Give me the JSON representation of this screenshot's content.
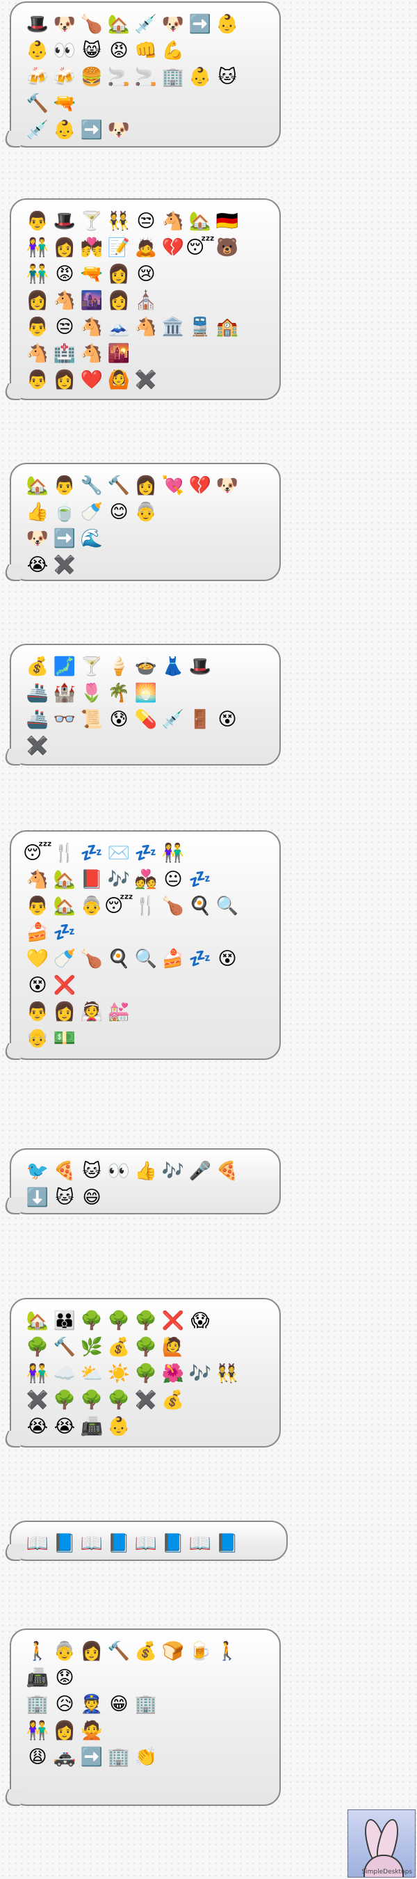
{
  "messages": [
    {
      "rows": [
        [
          "🎩",
          "🐶",
          "🍗",
          "🏡",
          "💉",
          "🐶",
          "➡️",
          "👶"
        ],
        [
          "👶",
          "👀",
          "😸",
          "😡",
          "👊",
          "💪"
        ],
        [
          "🍻",
          "🍻",
          "🍔",
          "🚬",
          "🚬",
          "🏢",
          "👶",
          "🐱"
        ],
        [
          "🔨",
          "🔫"
        ],
        [
          "💉",
          "👶",
          "➡️",
          "🐶"
        ]
      ]
    },
    {
      "rows": [
        [
          "👨",
          "🎩",
          "🍸",
          "👯",
          "😒",
          "🐴",
          "🏡",
          "🇩🇪"
        ],
        [
          "👫",
          "👩",
          "💏",
          "📝",
          "🙇",
          "💔",
          "😴",
          "🐻"
        ],
        [
          "👬",
          "😡",
          "🔫",
          "👩",
          "😢"
        ],
        [
          "👩",
          "🐴",
          "🌆",
          "👩",
          "⛪"
        ],
        [
          "👨",
          "😒",
          "🐴",
          "🗻",
          "🐴",
          "🏛️",
          "🚆",
          "🏫"
        ],
        [
          "🐴",
          "🏥",
          "🐴",
          "🌇"
        ],
        [
          "👨",
          "👩",
          "❤️",
          "🙆",
          "✖️"
        ]
      ]
    },
    {
      "rows": [
        [
          "🏡",
          "👨",
          "🔧",
          "🔨",
          "👩",
          "💘",
          "💔",
          "🐶"
        ],
        [
          "👍",
          "🍵",
          "🍼",
          "😊",
          "👵"
        ],
        [
          "🐶",
          "➡️",
          "🌊"
        ],
        [
          "😭",
          "✖️"
        ]
      ]
    },
    {
      "rows": [
        [
          "💰",
          "🗾",
          "🍸",
          "🍦",
          "🍲",
          "👗",
          "🎩"
        ],
        [
          "🚢",
          "🏰",
          "🌷",
          "🌴",
          "🌅"
        ],
        [
          "🚢",
          "👓",
          "📜",
          "😰",
          "💊",
          "💉",
          "🚪",
          "😵"
        ],
        [
          "✖️"
        ]
      ]
    },
    {
      "rows": [
        [
          "😴",
          "🍴",
          "💤",
          "✉️",
          "💤",
          "👫"
        ],
        [
          "🐴",
          "🏡",
          "📕",
          "🎶",
          "💑",
          "😐",
          "💤"
        ],
        [
          "👨",
          "🏡",
          "👵",
          "😴",
          "🍴",
          "🍗",
          "🍳",
          "🔍"
        ],
        [
          "🍰",
          "💤"
        ],
        [
          "💛",
          "🍼",
          "🍗",
          "🍳",
          "🔍",
          "🍰",
          "💤",
          "😵"
        ],
        [
          "😵",
          "❌"
        ],
        [
          "👨",
          "👩",
          "👰",
          "💒"
        ],
        [
          "👴",
          "💵"
        ]
      ]
    },
    {
      "rows": [
        [
          "🐦",
          "🍕",
          "🐱",
          "👀",
          "👍",
          "🎶",
          "🎤",
          "🍕"
        ],
        [
          "⬇️",
          "🐱",
          "😄"
        ]
      ]
    },
    {
      "rows": [
        [
          "🏡",
          "👪",
          "🌳",
          "🌳",
          "🌳",
          "❌",
          "😱"
        ],
        [
          "🌳",
          "🔨",
          "🌿",
          "💰",
          "🌳",
          "🙋"
        ],
        [
          "👫",
          "☁️",
          "⛅",
          "☀️",
          "🌳",
          "🌺",
          "🎶",
          "👯"
        ],
        [
          "✖️",
          "🌳",
          "🌳",
          "🌳",
          "✖️",
          "💰"
        ],
        [
          "😭",
          "😭",
          "📠",
          "👶"
        ]
      ]
    },
    {
      "rows": [
        [
          "📖",
          "📘",
          "📖",
          "📘",
          "📖",
          "📘",
          "📖",
          "📘"
        ]
      ]
    },
    {
      "rows": [
        [
          "🚶",
          "👵",
          "👩",
          "🔨",
          "💰",
          "🍞",
          "🍺",
          "🚶"
        ],
        [
          "📠",
          "😟"
        ],
        [
          "🏢",
          "😥",
          "👮",
          "😁",
          "🏢"
        ],
        [
          "👫",
          "👩",
          "🙅"
        ],
        [
          "😩",
          "🚓",
          "➡️",
          "🏢",
          "👏"
        ]
      ]
    }
  ],
  "badge": {
    "label": "SimpleDesktops"
  }
}
